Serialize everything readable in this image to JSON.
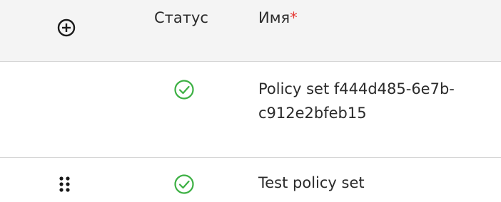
{
  "header": {
    "status_label": "Статус",
    "name_label": "Имя",
    "required_mark": "*"
  },
  "rows": [
    {
      "status": "success-check-icon",
      "name_lines": [
        "Policy set f444d485-6e7b-",
        "c912e2bfeb15"
      ]
    },
    {
      "status": "success-check-icon",
      "name": "Test policy set"
    }
  ],
  "colors": {
    "header_bg": "#f4f4f4",
    "success": "#3cb043",
    "required": "#e53935",
    "divider": "#d6d6d6"
  }
}
